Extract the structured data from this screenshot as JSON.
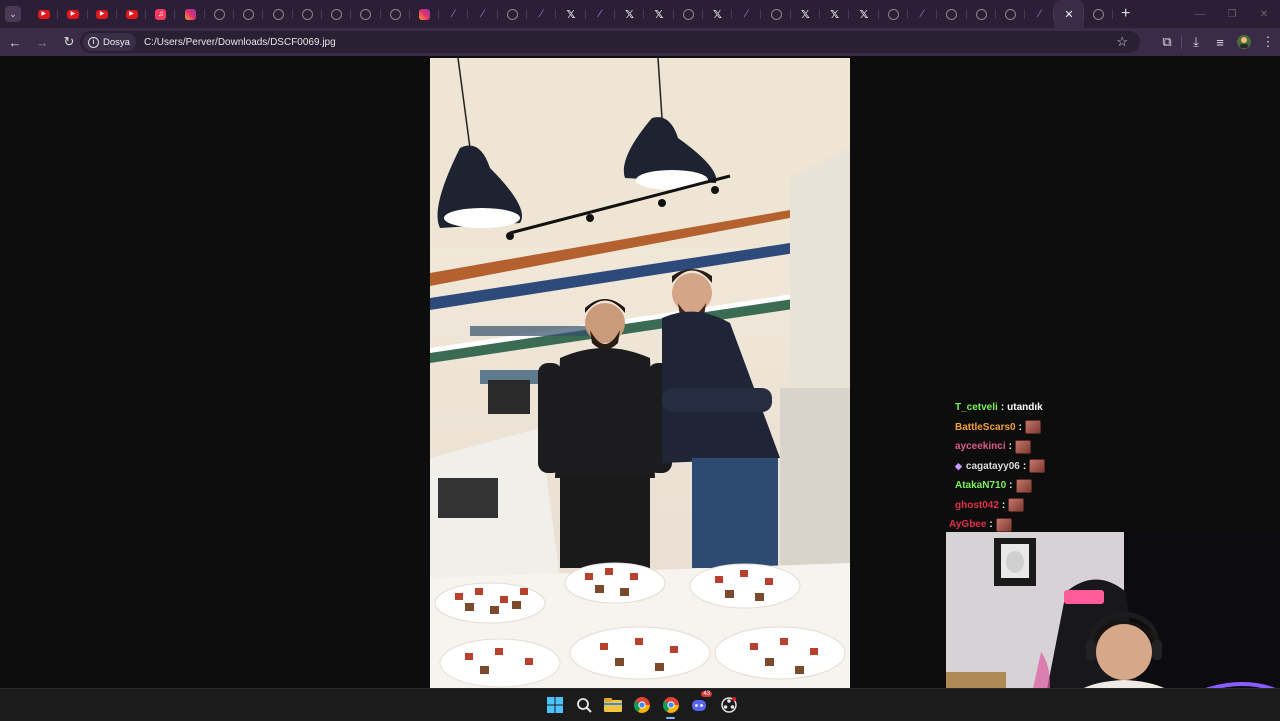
{
  "browser": {
    "tabs": [
      {
        "icon": "youtube-icon"
      },
      {
        "icon": "youtube-icon"
      },
      {
        "icon": "youtube-icon"
      },
      {
        "icon": "youtube-icon"
      },
      {
        "icon": "music-icon"
      },
      {
        "icon": "instagram-icon"
      },
      {
        "icon": "globe-icon"
      },
      {
        "icon": "globe-icon"
      },
      {
        "icon": "globe-icon"
      },
      {
        "icon": "globe-icon"
      },
      {
        "icon": "globe-icon"
      },
      {
        "icon": "globe-icon"
      },
      {
        "icon": "globe-icon"
      },
      {
        "icon": "instagram-icon"
      },
      {
        "icon": "feather-icon"
      },
      {
        "icon": "feather-icon"
      },
      {
        "icon": "globe-icon"
      },
      {
        "icon": "feather-icon"
      },
      {
        "icon": "x-icon"
      },
      {
        "icon": "feather-icon"
      },
      {
        "icon": "x-icon"
      },
      {
        "icon": "x-icon"
      },
      {
        "icon": "globe-icon"
      },
      {
        "icon": "x-icon"
      },
      {
        "icon": "feather-icon"
      },
      {
        "icon": "globe-icon"
      },
      {
        "icon": "x-icon"
      },
      {
        "icon": "x-icon"
      },
      {
        "icon": "x-icon"
      },
      {
        "icon": "globe-icon"
      },
      {
        "icon": "feather-icon"
      },
      {
        "icon": "globe-icon"
      },
      {
        "icon": "globe-icon"
      },
      {
        "icon": "globe-icon"
      },
      {
        "icon": "feather-icon"
      }
    ],
    "active_tab_close": "✕",
    "new_tab": "+",
    "address": {
      "chip_label": "Dosya",
      "url": "C:/Users/Perver/Downloads/DSCF0069.jpg"
    }
  },
  "chat": {
    "messages": [
      {
        "user": "T_cetveli",
        "color": "#7cf05a",
        "text": "utandık",
        "emote": false
      },
      {
        "user": "BattleScars0",
        "color": "#f0a040",
        "text": "",
        "emote": true
      },
      {
        "user": "ayceekinci",
        "color": "#e05a8a",
        "text": "",
        "emote": true
      },
      {
        "user": "cagatayy06",
        "color": "#dcdcdc",
        "text": "",
        "emote": true,
        "badge": true
      },
      {
        "user": "AtakaN710",
        "color": "#7cf05a",
        "text": "",
        "emote": true
      },
      {
        "user": "ghost042",
        "color": "#e0304a",
        "text": "",
        "emote": true
      },
      {
        "user": "AyGbee",
        "color": "#e0304a",
        "text": "",
        "emote": true
      }
    ]
  },
  "taskbar": {
    "icons": [
      "windows-start-icon",
      "search-icon",
      "file-explorer-icon",
      "chrome-icon",
      "chrome-icon",
      "discord-icon",
      "obs-icon"
    ],
    "discord_badge": "43"
  }
}
